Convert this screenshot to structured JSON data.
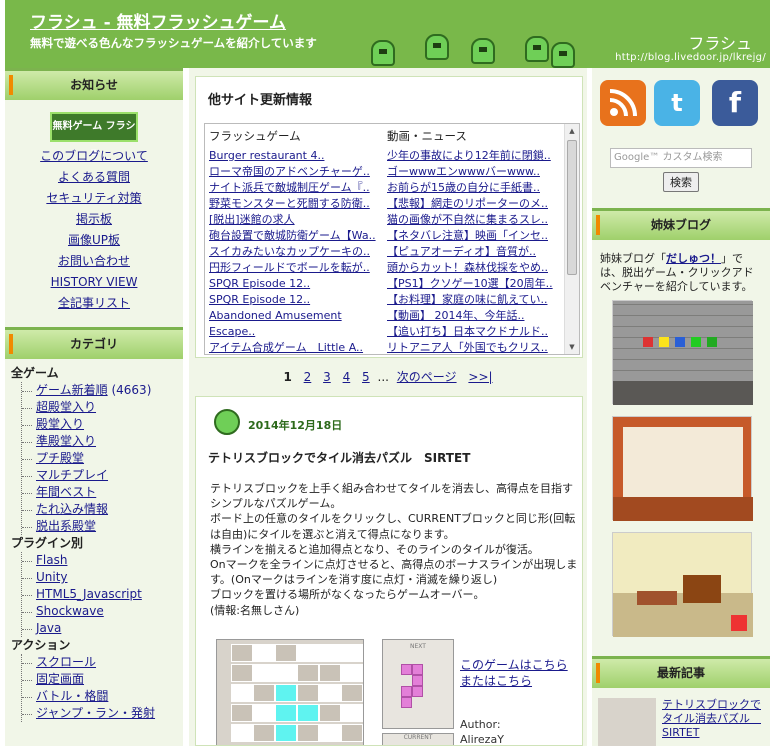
{
  "header": {
    "title": "フラシュ - 無料フラッシュゲーム",
    "description": "無料で遊べる色んなフラッシュゲームを紹介しています",
    "brand": "フラシュ",
    "url": "http://blog.livedoor.jp/lkrejg/"
  },
  "left": {
    "notice_heading": "お知らせ",
    "notice_logo": "無料ゲーム フラシュ",
    "notice_links": [
      "このブログについて",
      "よくある質問",
      "セキュリティ対策",
      "掲示板",
      "画像UP板",
      "お問い合わせ",
      "HISTORY VIEW",
      "全記事リスト"
    ],
    "category_heading": "カテゴリ",
    "categories": [
      {
        "title": "全ゲーム",
        "items": [
          "ゲーム新着順",
          "超殿堂入り",
          "殿堂入り",
          "準殿堂入り",
          "プチ殿堂",
          "マルチプレイ",
          "年間ベスト",
          "たれ込み情報",
          "脱出系殿堂"
        ],
        "count": "(4663)"
      },
      {
        "title": "プラグイン別",
        "items": [
          "Flash",
          "Unity",
          "HTML5_Javascript",
          "Shockwave",
          "Java"
        ]
      },
      {
        "title": "アクション",
        "items": [
          "スクロール",
          "固定画面",
          "バトル・格闘",
          "ジャンプ・ラン・発射"
        ]
      }
    ]
  },
  "center": {
    "updates_title": "他サイト更新情報",
    "col1_head": "フラッシュゲーム",
    "col2_head": "動画・ニュース",
    "col1": [
      "Burger restaurant 4..",
      "ローマ帝国のアドベンチャーゲ..",
      "ナイト派兵で敵城制圧ゲーム『..",
      "野菜モンスターと死闘する防衛..",
      "[脱出]迷館の求人",
      "砲台設置で敵城防衛ゲーム【Wa..",
      "スイカみたいなカップケーキの..",
      "円形フィールドでボールを転が..",
      "SPQR Episode 12..",
      "SPQR Episode 12..",
      "Abandoned Amusement Escape..",
      "アイテム合成ゲーム　Little A.."
    ],
    "col2": [
      "少年の事故により12年前に閉鎖..",
      "ゴーwwwエンwwwバーwww..",
      "お前らが15歳の自分に手紙書..",
      "【悲報】網走のリポーターのメ..",
      "猫の画像が不自然に集まるスレ..",
      "【ネタバレ注意】映画「インセ..",
      "【ピュアオーディオ】音質が..",
      "頭からカット！森林伐採をやめ..",
      "【PS1】クソゲー10選【20周年..",
      "【お料理】家庭の味に飢えてい..",
      "【動画】 2014年、今年話..",
      "【追い打ち】日本マクドナルド..",
      "リトアニア人「外国でもクリス.."
    ],
    "pager": {
      "current": "1",
      "pages": [
        "2",
        "3",
        "4",
        "5"
      ],
      "ellipsis": "...",
      "next": "次のページ",
      "last": ">>|"
    },
    "post": {
      "date": "2014年12月18日",
      "title": "テトリスブロックでタイル消去パズル　SIRTET",
      "body": [
        "テトリスブロックを上手く組み合わせてタイルを消去し、高得点を目指す",
        "シンプルなパズルゲーム。",
        "ボード上の任意のタイルをクリックし、CURRENTブロックと同じ形(回転",
        "は自由)にタイルを選ぶと消えて得点になります。",
        "横ラインを揃えると追加得点となり、そのラインのタイルが復活。",
        "Onマークを全ラインに点灯させると、高得点のボーナスラインが出現しま",
        "す。(Onマークはラインを消す度に点灯・消滅を繰り返し)",
        "ブロックを置ける場所がなくなったらゲームオーバー。",
        "(情報:名無しさん)"
      ],
      "next_label": "NEXT",
      "current_label": "CURRENT",
      "play_here": "このゲームはこちら",
      "or_here": "またはこちら",
      "author_label": "Author:",
      "author_name": "AlirezaY"
    }
  },
  "right": {
    "social": [
      "RSS",
      "Twitter",
      "Facebook"
    ],
    "search_placeholder": "Google™ カスタム検索",
    "search_button": "検索",
    "sister_heading": "姉妹ブログ",
    "sister_text_pre": "姉妹ブログ「",
    "sister_name": "だしゅつ！",
    "sister_text_post": "」では、脱出ゲーム・クリックアドベンチャーを紹介しています。",
    "latest_heading": "最新記事",
    "latest_title": "テトリスブロックでタイル消去パズル　SIRTET"
  }
}
